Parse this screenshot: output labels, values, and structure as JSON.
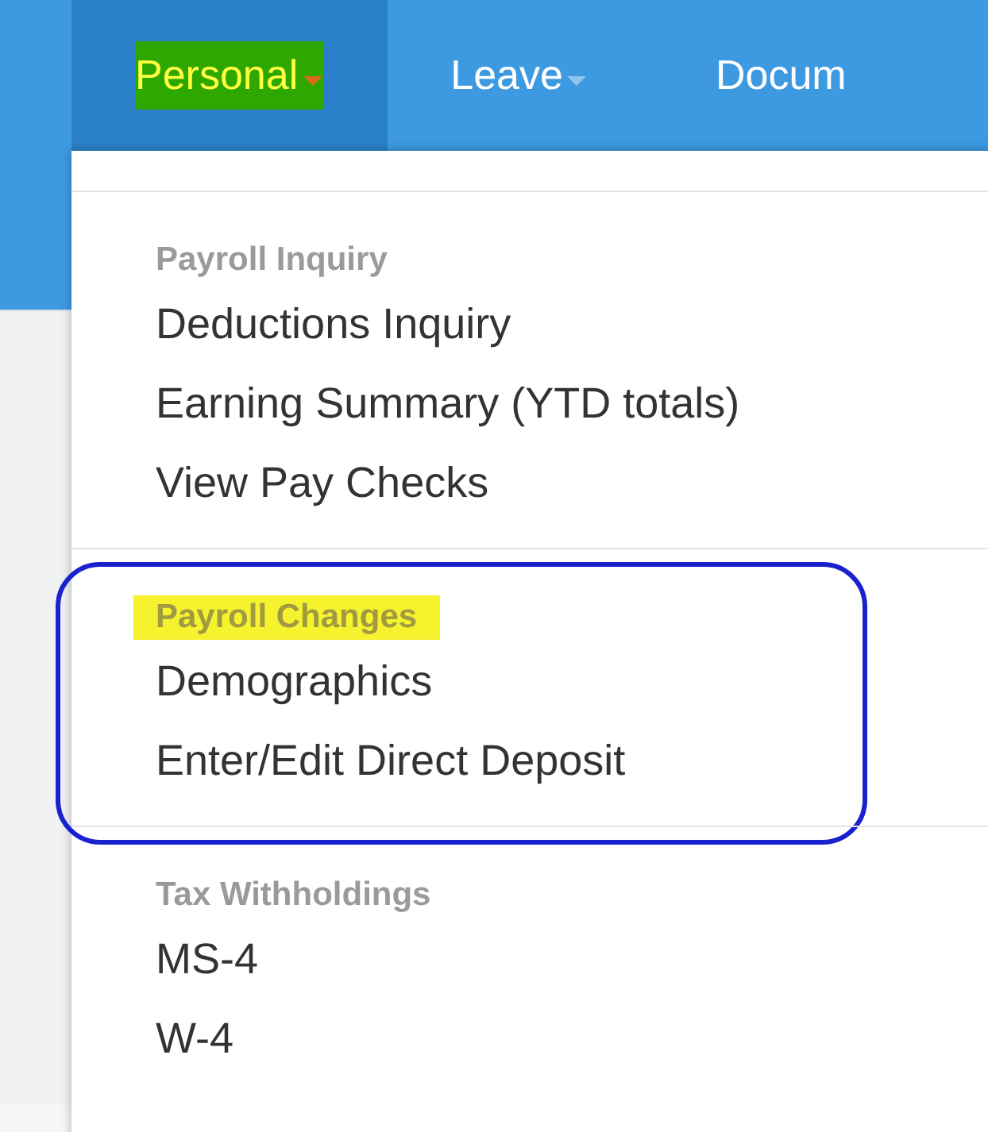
{
  "nav": {
    "tabs": [
      {
        "label": "Personal",
        "caret": true,
        "selected": true,
        "highlighted": true
      },
      {
        "label": "Leave",
        "caret": true,
        "selected": false,
        "highlighted": false
      },
      {
        "label": "Docum",
        "caret": false,
        "selected": false,
        "highlighted": false
      }
    ]
  },
  "menu": {
    "sections": [
      {
        "header": "Payroll Inquiry",
        "highlighted": false,
        "circled": false,
        "items": [
          "Deductions Inquiry",
          "Earning Summary (YTD totals)",
          "View Pay Checks"
        ]
      },
      {
        "header": "Payroll Changes",
        "highlighted": true,
        "circled": true,
        "items": [
          "Demographics",
          "Enter/Edit Direct Deposit"
        ]
      },
      {
        "header": "Tax Withholdings",
        "highlighted": false,
        "circled": false,
        "items": [
          "MS-4",
          "W-4"
        ]
      }
    ]
  }
}
